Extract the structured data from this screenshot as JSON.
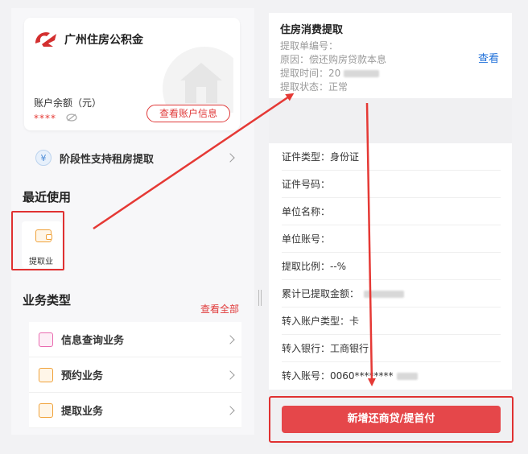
{
  "left": {
    "brand": "广州住房公积金",
    "balance_label": "账户余额（元）",
    "balance_value": "****",
    "view_account_button": "查看账户信息",
    "rent_link": "阶段性支持租房提取",
    "recent_title": "最近使用",
    "recent_item_label": "提取业",
    "business_title": "业务类型",
    "see_all": "查看全部",
    "business_items": [
      {
        "label": "信息查询业务",
        "icon": "document-icon",
        "color": "#e96bb0"
      },
      {
        "label": "预约业务",
        "icon": "calendar-icon",
        "color": "#f0a23a"
      },
      {
        "label": "提取业务",
        "icon": "wallet-icon",
        "color": "#f0a23a"
      }
    ]
  },
  "right": {
    "top_card": {
      "title": "住房消费提取",
      "line1": "提取单编号：",
      "line2": "原因：偿还购房贷款本息",
      "line3": "提取时间：20",
      "line4": "提取状态：正常",
      "view": "查看"
    },
    "details": [
      "证件类型：身份证",
      "证件号码：",
      "单位名称：",
      "单位账号：",
      "提取比例：--%",
      "累计已提取金额：",
      "转入账户类型：卡",
      "转入银行：工商银行",
      "转入账号：0060********"
    ],
    "action_button": "新增还商贷/提首付"
  },
  "colors": {
    "accent_red": "#e5474a",
    "highlight_red": "#e03131",
    "link_blue": "#1e6fd9"
  }
}
